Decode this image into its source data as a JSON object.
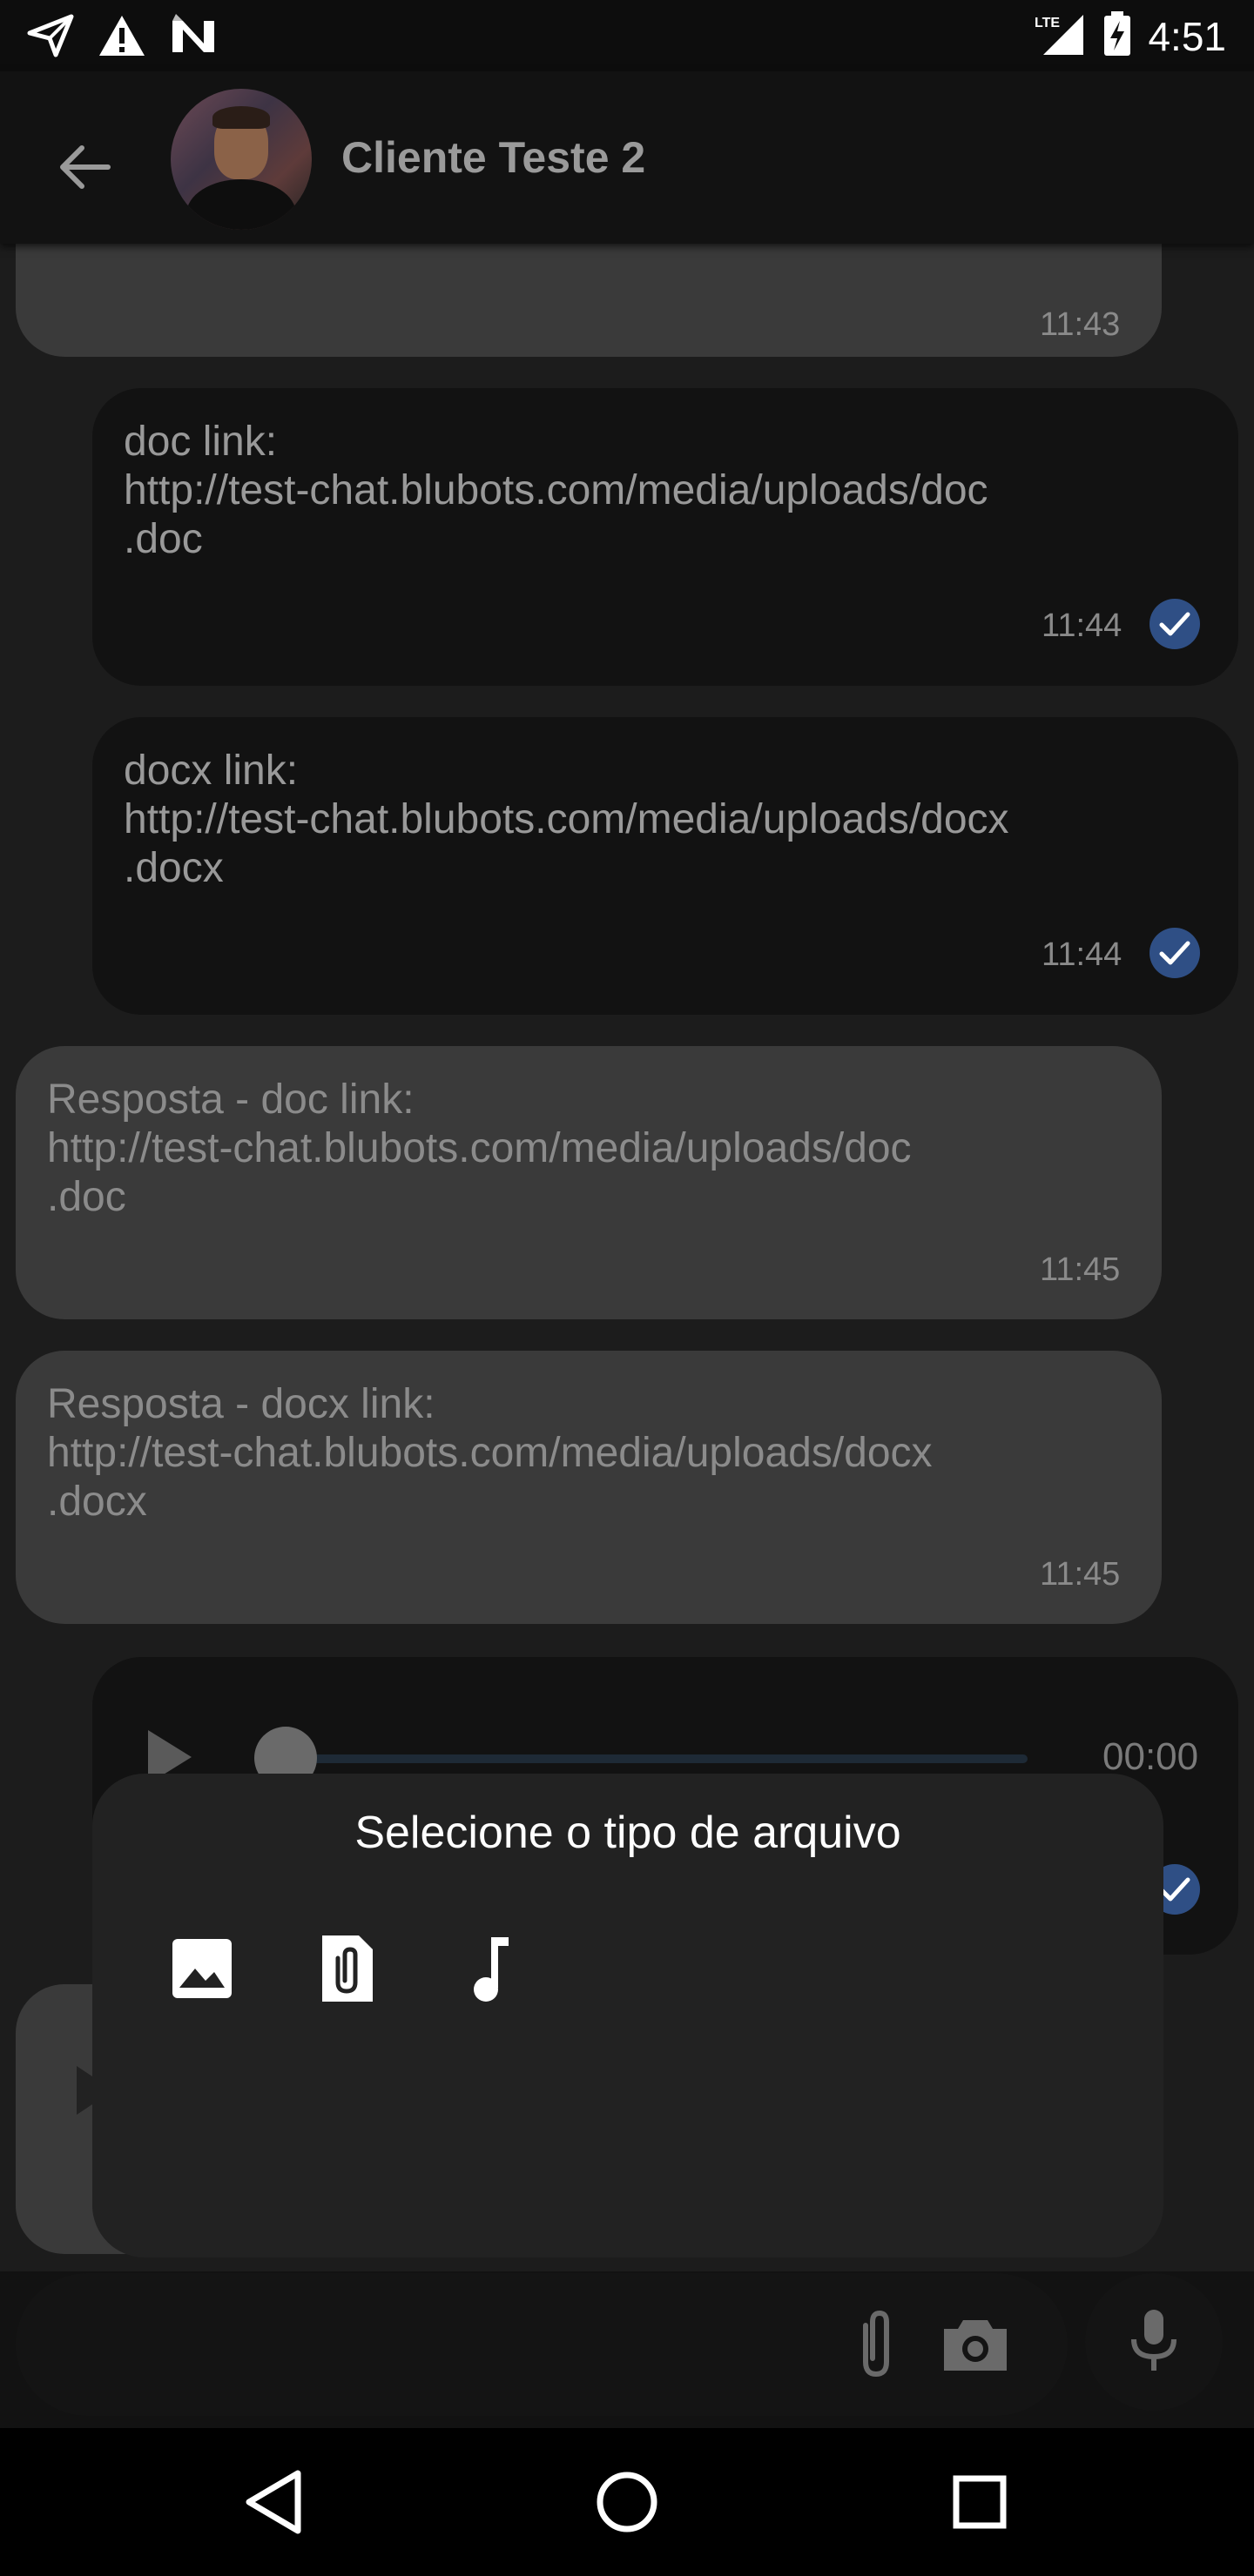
{
  "status_bar": {
    "time": "4:51",
    "network": "LTE",
    "icons": [
      "send-notification-icon",
      "warning-icon",
      "n-logo-icon",
      "signal-icon",
      "battery-charging-icon"
    ]
  },
  "header": {
    "contact_name": "Cliente Teste 2",
    "back_icon": "arrow-back-icon"
  },
  "messages": [
    {
      "direction": "incoming",
      "text": "",
      "time": "11:43"
    },
    {
      "direction": "outgoing",
      "text": "doc link:\nhttp://test-chat.blubots.com/media/uploads/doc\n.doc",
      "time": "11:44",
      "read": true
    },
    {
      "direction": "outgoing",
      "text": "docx link:\nhttp://test-chat.blubots.com/media/uploads/docx\n.docx",
      "time": "11:44",
      "read": true
    },
    {
      "direction": "incoming",
      "text": "Resposta - doc link:\nhttp://test-chat.blubots.com/media/uploads/doc\n.doc",
      "time": "11:45"
    },
    {
      "direction": "incoming",
      "text": "Resposta - docx link:\nhttp://test-chat.blubots.com/media/uploads/docx\n.docx",
      "time": "11:45"
    },
    {
      "direction": "outgoing",
      "type": "audio",
      "duration": "00:00",
      "progress": 0,
      "read": true
    }
  ],
  "file_type_sheet": {
    "title": "Selecione o tipo de arquivo",
    "options": [
      "image-icon",
      "document-attachment-icon",
      "music-note-icon"
    ]
  },
  "input_bar": {
    "attach_icon": "paperclip-icon",
    "camera_icon": "camera-icon",
    "mic_icon": "microphone-icon"
  },
  "nav_bar": {
    "icons": [
      "back-triangle-icon",
      "home-circle-icon",
      "recents-square-icon"
    ]
  },
  "colors": {
    "read_check": "#2f4f85",
    "incoming_bubble": "#3a3a3a",
    "outgoing_bubble": "#121212",
    "sheet_background": "#222222"
  }
}
